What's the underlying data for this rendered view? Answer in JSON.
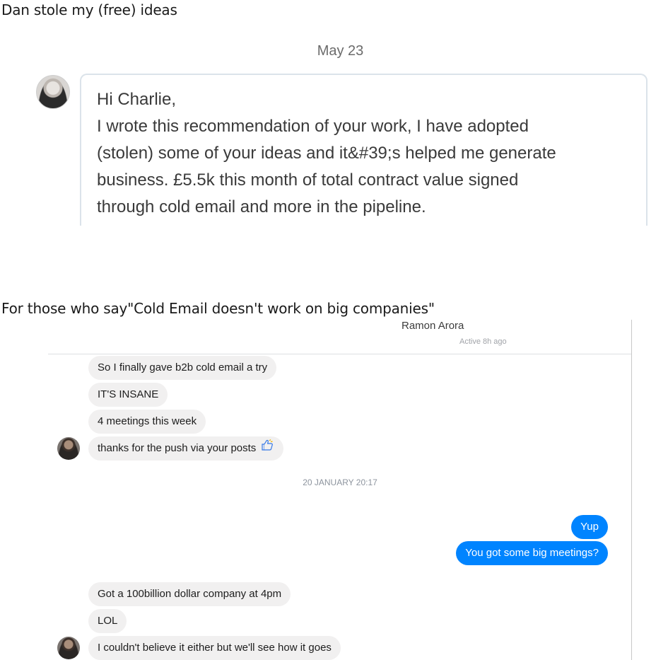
{
  "section1": {
    "heading": "Dan stole my (free) ideas",
    "date_label": "May 23",
    "message_lines": [
      "Hi Charlie,",
      "I wrote this recommendation of your work, I have adopted",
      "(stolen) some of your ideas and it&#39;s helped me generate",
      "business. £5.5k this month of total contract value signed",
      "through cold email and more in the pipeline."
    ]
  },
  "section2": {
    "heading": "For those who say\"Cold Email doesn't work on big companies\"",
    "contact": {
      "name": "Ramon Arora",
      "status": "Active 8h ago"
    },
    "messages": [
      {
        "text": "So I finally gave b2b cold email a try"
      },
      {
        "text": "IT'S INSANE"
      },
      {
        "text": "4 meetings this week"
      },
      {
        "text": "thanks for the push via your posts"
      },
      {
        "timestamp": "20 JANUARY 20:17"
      },
      {
        "text": "Yup"
      },
      {
        "text": "You got some big meetings?"
      },
      {
        "text": "Got a 100billion dollar company at 4pm"
      },
      {
        "text": "LOL"
      },
      {
        "text": "I couldn't believe it either but we'll see how it goes"
      }
    ],
    "icons": {
      "like": "thumbs-up-icon",
      "avatar": "contact-avatar"
    },
    "colors": {
      "outgoing_bubble": "#0084ff",
      "incoming_bubble": "#f1f0f0"
    }
  }
}
